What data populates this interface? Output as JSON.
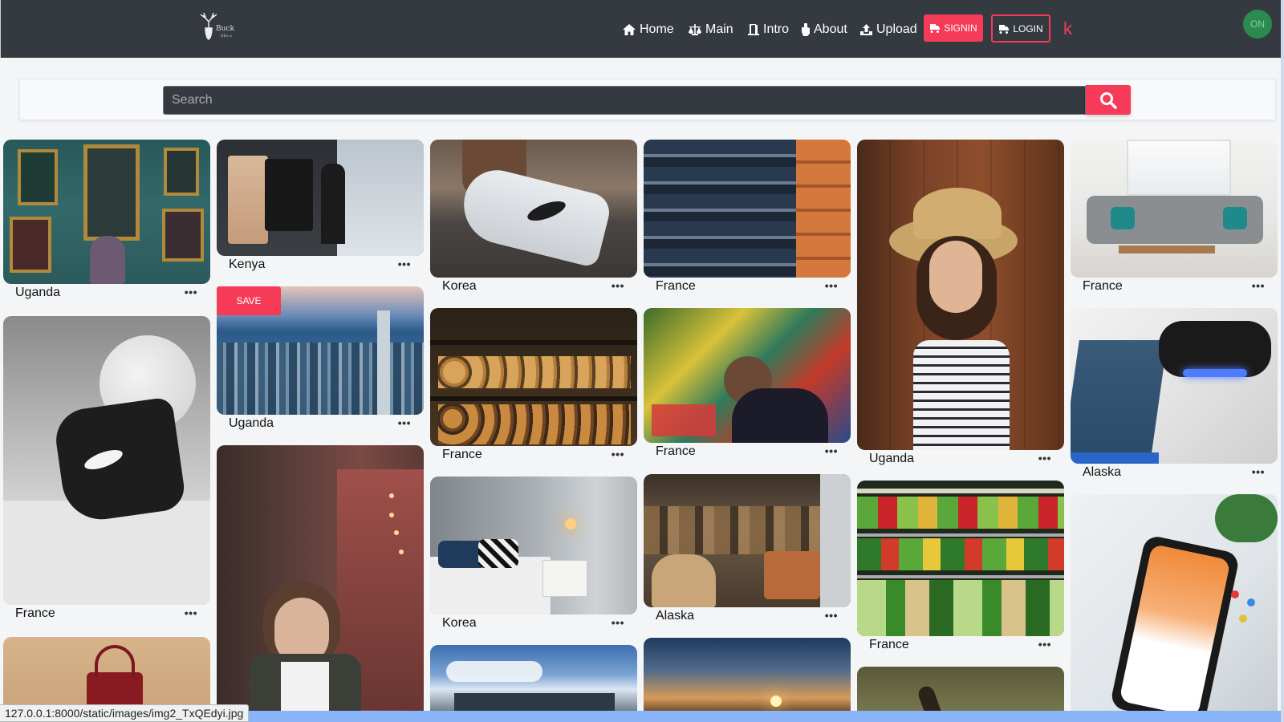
{
  "brand": {
    "name": "Buck",
    "tagline": "Sho s"
  },
  "nav": {
    "home": "Home",
    "main": "Main",
    "intro": "Intro",
    "about": "About",
    "upload": "Upload",
    "signin": "SIGNIN",
    "login": "LOGIN",
    "k": "k",
    "avatar": "ON"
  },
  "search": {
    "placeholder": "Search"
  },
  "save_label": "SAVE",
  "more_label": "•••",
  "cards": {
    "c1": "Uganda",
    "c2": "France",
    "c4": "Kenya",
    "c5": "Uganda",
    "c7": "Korea",
    "c8": "France",
    "c9": "Korea",
    "c11": "France",
    "c12": "France",
    "c13": "Alaska",
    "c15": "Uganda",
    "c16": "France",
    "c18": "France",
    "c19": "Alaska"
  },
  "status_url": "127.0.0.1:8000/static/images/img2_TxQEdyi.jpg",
  "colors": {
    "accent": "#f53b57",
    "navbar": "#343a40"
  }
}
